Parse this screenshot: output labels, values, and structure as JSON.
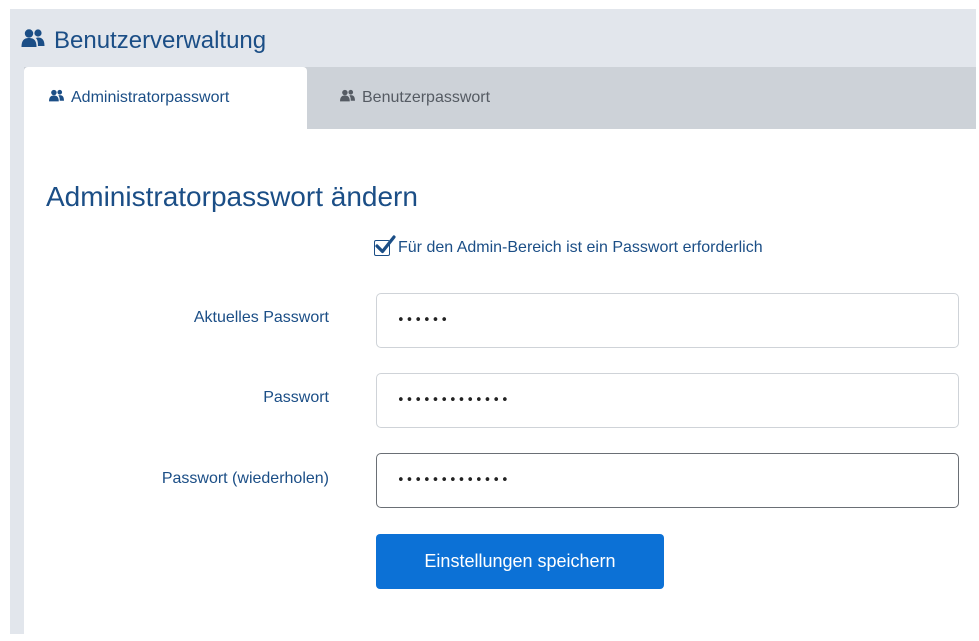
{
  "header": {
    "title": "Benutzerverwaltung",
    "icon": "users-icon"
  },
  "tabs": [
    {
      "label": "Administratorpasswort",
      "active": true,
      "icon": "users-icon"
    },
    {
      "label": "Benutzerpasswort",
      "active": false,
      "icon": "users-icon"
    }
  ],
  "form": {
    "title": "Administratorpasswort ändern",
    "checkbox": {
      "label": "Für den Admin-Bereich ist ein Passwort erforderlich",
      "checked": true
    },
    "fields": [
      {
        "label": "Aktuelles Passwort",
        "value": "••••••"
      },
      {
        "label": "Passwort",
        "value": "•••••••••••••"
      },
      {
        "label": "Passwort (wiederholen)",
        "value": "•••••••••••••"
      }
    ],
    "save_label": "Einstellungen speichern"
  },
  "colors": {
    "accent": "#1b4e86",
    "button": "#0c71d6",
    "page_bg": "#e2e6ec",
    "tabbar_bg": "#cdd2d8"
  }
}
